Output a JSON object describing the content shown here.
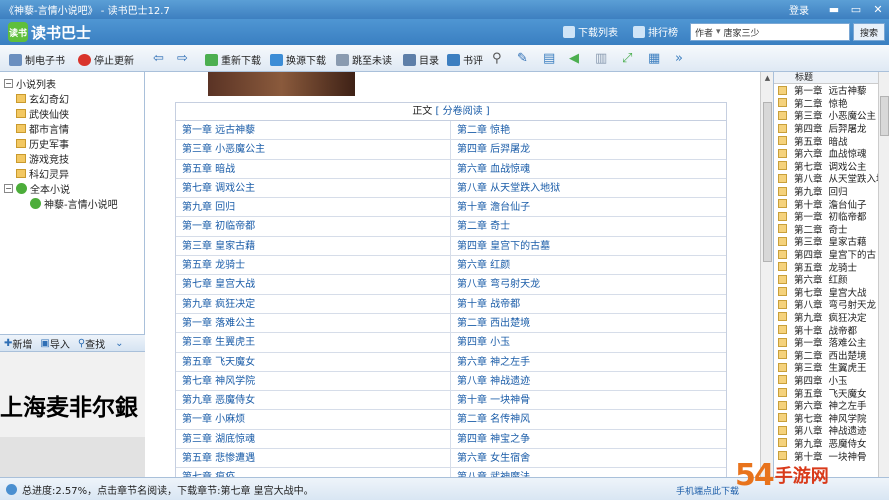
{
  "window": {
    "title": "《神藜-言情小说吧》 - 读书巴士12.7",
    "login": "登录",
    "min": "▬",
    "max": "▭",
    "close": "✕"
  },
  "header": {
    "logo_badge": "读书",
    "logo_name": "读书巴士",
    "download_list": "下载列表",
    "ranking": "排行榜",
    "search_field": "作者",
    "search_value": "唐家三少",
    "search_button": "搜索"
  },
  "toolbar": {
    "make_ebook": "制电子书",
    "stop_update": "停止更新",
    "redownload": "重新下载",
    "switch_source": "换源下载",
    "jump_unread": "跳至未读",
    "toc": "目录",
    "review": "书评"
  },
  "tree": {
    "root": "小说列表",
    "categories": [
      "玄幻奇幻",
      "武侠仙侠",
      "都市言情",
      "历史军事",
      "游戏竞技",
      "科幻灵异"
    ],
    "all_novels": "全本小说",
    "current_book": "神藜-言情小说吧"
  },
  "left_toolbar": {
    "add": "新增",
    "import": "导入",
    "find": "查找"
  },
  "ad": {
    "text": "上海麦非尔銀"
  },
  "toc": {
    "header_text": "正文",
    "header_link": "分卷阅读",
    "rows": [
      [
        "第一章 远古神藜",
        "第二章 惊艳"
      ],
      [
        "第三章 小恶魔公主",
        "第四章 后羿屠龙"
      ],
      [
        "第五章 暗战",
        "第六章 血战惊魂"
      ],
      [
        "第七章 调戏公主",
        "第八章 从天堂跌入地狱"
      ],
      [
        "第九章 回归",
        "第十章 澹台仙子"
      ],
      [
        "第一章 初临帝都",
        "第二章 奇士"
      ],
      [
        "第三章 皇家古藉",
        "第四章 皇宫下的古墓"
      ],
      [
        "第五章 龙骑士",
        "第六章 红颜"
      ],
      [
        "第七章 皇宫大战",
        "第八章 弯弓射天龙"
      ],
      [
        "第九章 疯狂决定",
        "第十章 战帝都"
      ],
      [
        "第一章 落难公主",
        "第二章 西出楚境"
      ],
      [
        "第三章 生翼虎王",
        "第四章 小玉"
      ],
      [
        "第五章 飞天魔女",
        "第六章 神之左手"
      ],
      [
        "第七章 神风学院",
        "第八章 神战遗迹"
      ],
      [
        "第九章 恶魔侍女",
        "第十章 一块神骨"
      ],
      [
        "第一章 小麻烦",
        "第二章 名传神风"
      ],
      [
        "第三章 湖底惊魂",
        "第四章 神宝之争"
      ],
      [
        "第五章 悲惨遭遇",
        "第六章 女生宿舍"
      ],
      [
        "第七章 瘟疫",
        "第八章 武神魔法"
      ]
    ]
  },
  "chapter_list": {
    "header": "标题",
    "items": [
      [
        "第一章",
        "远古神藜"
      ],
      [
        "第二章",
        "惊艳"
      ],
      [
        "第三章",
        "小恶魔公主"
      ],
      [
        "第四章",
        "后羿屠龙"
      ],
      [
        "第五章",
        "暗战"
      ],
      [
        "第六章",
        "血战惊魂"
      ],
      [
        "第七章",
        "调戏公主"
      ],
      [
        "第八章",
        "从天堂跌入地"
      ],
      [
        "第九章",
        "回归"
      ],
      [
        "第十章",
        "澹台仙子"
      ],
      [
        "第一章",
        "初临帝都"
      ],
      [
        "第二章",
        "奇士"
      ],
      [
        "第三章",
        "皇家古藉"
      ],
      [
        "第四章",
        "皇宫下的古"
      ],
      [
        "第五章",
        "龙骑士"
      ],
      [
        "第六章",
        "红颜"
      ],
      [
        "第七章",
        "皇宫大战"
      ],
      [
        "第八章",
        "弯弓射天龙"
      ],
      [
        "第九章",
        "疯狂决定"
      ],
      [
        "第十章",
        "战帝都"
      ],
      [
        "第一章",
        "落难公主"
      ],
      [
        "第二章",
        "西出楚境"
      ],
      [
        "第三章",
        "生翼虎王"
      ],
      [
        "第四章",
        "小玉"
      ],
      [
        "第五章",
        "飞天魔女"
      ],
      [
        "第六章",
        "神之左手"
      ],
      [
        "第七章",
        "神风学院"
      ],
      [
        "第八章",
        "神战遗迹"
      ],
      [
        "第九章",
        "恶魔侍女"
      ],
      [
        "第十章",
        "一块神骨"
      ]
    ]
  },
  "status": {
    "text": "总进度:2.57%，点击章节名阅读，下载章节:第七章 皇宫大战中。",
    "right": "手机端点此下载"
  },
  "watermark": {
    "a": "54",
    "b": "手游网"
  },
  "colors": {
    "title_bar": "#3d7fc0",
    "link": "#1a5ca8",
    "accent_green": "#5fbf3b"
  }
}
